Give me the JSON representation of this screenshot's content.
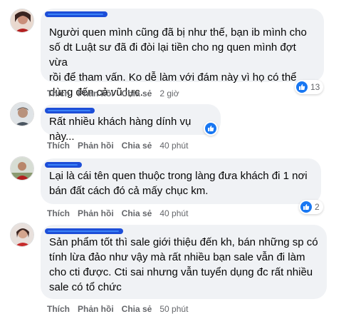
{
  "comments": [
    {
      "text": "Người quen mình cũng đã bị như thế, bạn ib mình cho\nsố dt Luật sư đã đi đòi lại tiền cho ng quen mình đợt vừa\nrồi để tham vấn. Ko dễ làm với đám này vì họ có thể\ndùng đến cả vũ lực.",
      "like_label": "Thích",
      "reply_label": "Phản hồi",
      "share_label": "Chia sẻ",
      "time": "2 giờ",
      "reaction_count": "13"
    },
    {
      "text": "Rất nhiều khách hàng dính vụ này...",
      "like_label": "Thích",
      "reply_label": "Phản hồi",
      "share_label": "Chia sẻ",
      "time": "40 phút",
      "reaction_count": ""
    },
    {
      "text": "Lại là cái tên quen thuộc trong làng đưa khách đi 1 nơi\nbán đất cách đó cả mấy chục km.",
      "like_label": "Thích",
      "reply_label": "Phản hồi",
      "share_label": "Chia sẻ",
      "time": "40 phút",
      "reaction_count": "2"
    },
    {
      "text": "Sản phẩm tốt thì sale giới thiệu đến kh, bán những sp có\ntính lừa đảo như vậy mà rất nhiều bạn sale vẫn đi làm\ncho cti được. Cti sai nhưng vẫn tuyển dụng đc rất nhiều\nsale có tổ chức",
      "like_label": "Thích",
      "reply_label": "Phản hồi",
      "share_label": "Chia sẻ",
      "time": "50 phút",
      "reaction_count": ""
    }
  ],
  "colors": {
    "bubble": "#f0f2f5",
    "meta_text": "#65676b",
    "like_blue": "#1877f2",
    "redaction": "#1d4ed8"
  }
}
